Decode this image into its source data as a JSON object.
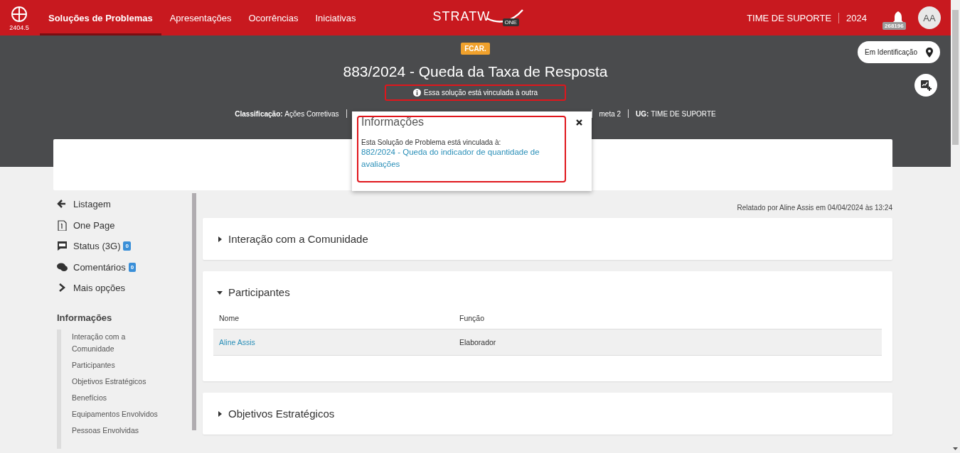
{
  "header": {
    "version": "2404.5",
    "nav": [
      {
        "label": "Soluções de Problemas",
        "selected": true
      },
      {
        "label": "Apresentações",
        "selected": false
      },
      {
        "label": "Ocorrências",
        "selected": false
      },
      {
        "label": "Iniciativas",
        "selected": false
      }
    ],
    "brand": "STRATW",
    "brand_badge": "ONE",
    "team": "TIME DE SUPORTE",
    "year": "2024",
    "notifications": "268196",
    "avatar": "AA"
  },
  "hero": {
    "tag": "FCAR.",
    "title": "883/2024 - Queda da Taxa de Resposta",
    "link_notice": "Essa solução está vinculada à outra",
    "meta": [
      {
        "label": "Classificação:",
        "value": "Ações Corretivas"
      },
      {
        "value": "meta 2"
      },
      {
        "label": "UG:",
        "value": "TIME DE SUPORTE"
      }
    ],
    "status": "Em Identificação"
  },
  "popup": {
    "title": "Informações",
    "text": "Esta Solução de Problema está vinculada à:",
    "link": "882/2024 - Queda do indicador de quantidade de avaliações"
  },
  "sidebar": {
    "actions": [
      {
        "kind": "back",
        "label": "Listagem"
      },
      {
        "kind": "page",
        "label": "One Page"
      },
      {
        "kind": "status",
        "label": "Status (3G)",
        "badge": "0"
      },
      {
        "kind": "comments",
        "label": "Comentários",
        "badge": "0"
      },
      {
        "kind": "more",
        "label": "Mais opções"
      }
    ],
    "section_title": "Informações",
    "sections": [
      "Interação com a Comunidade",
      "Participantes",
      "Objetivos Estratégicos",
      "Benefícios",
      "Equipamentos Envolvidos",
      "Pessoas Envolvidas"
    ]
  },
  "main": {
    "reported": "Relatado por Aline Assis em 04/04/2024 às 13:24",
    "panels": [
      {
        "title": "Interação com a Comunidade",
        "expanded": false
      },
      {
        "title": "Participantes",
        "expanded": true,
        "columns": [
          "Nome",
          "Função"
        ],
        "rows": [
          [
            "Aline Assis",
            "Elaborador"
          ]
        ]
      },
      {
        "title": "Objetivos Estratégicos",
        "expanded": false
      }
    ]
  }
}
